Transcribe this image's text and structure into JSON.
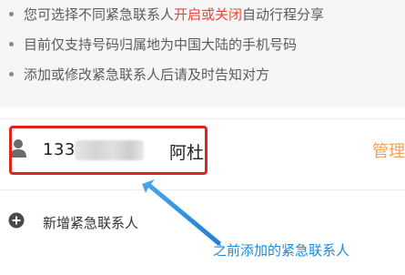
{
  "notice": {
    "items": [
      {
        "before": "您可选择不同紧急联系人",
        "highlight": "开启或关闭",
        "after": "自动行程分享"
      },
      {
        "before": "目前仅支持号码归属地为中国大陆的手机号码",
        "highlight": "",
        "after": ""
      },
      {
        "before": "添加或修改紧急联系人后请及时告知对方",
        "highlight": "",
        "after": ""
      }
    ],
    "highlight_color": "#e8463b"
  },
  "contact": {
    "phone_prefix": "133",
    "name": "阿杜",
    "icon": "person-icon"
  },
  "manage_label": "管理",
  "add_contact": {
    "label": "新增紧急联系人",
    "icon": "plus-circle-icon"
  },
  "annotation": {
    "text": "之前添加的紧急联系人",
    "color": "#1e8ad6"
  },
  "colors": {
    "accent": "#f0a259",
    "box": "#e0251f"
  }
}
